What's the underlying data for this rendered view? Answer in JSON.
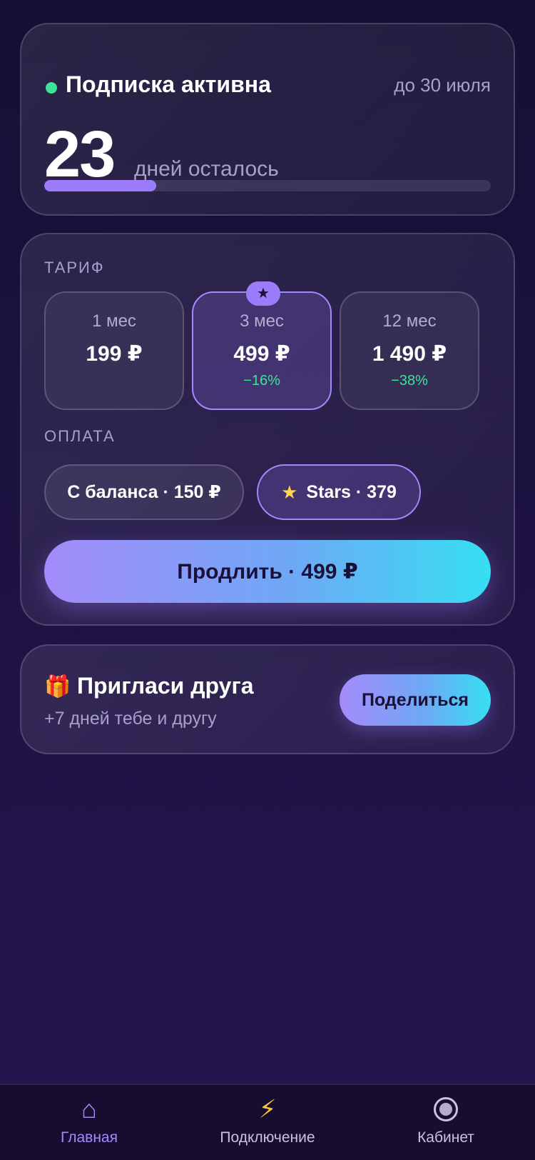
{
  "status": {
    "title": "Подписка активна",
    "until": "до 30 июля",
    "days_left": "23",
    "days_label": "дней осталось",
    "progress_fraction": 0.25,
    "dot_color": "#3ee39a"
  },
  "tariff": {
    "label": "ТАРИФ",
    "plans": [
      {
        "period": "1 мес",
        "price": "199 ₽",
        "discount": "",
        "selected": false
      },
      {
        "period": "3 мес",
        "price": "499 ₽",
        "discount": "−16%",
        "selected": true,
        "badge": "★"
      },
      {
        "period": "12 мес",
        "price": "1 490 ₽",
        "discount": "−38%",
        "selected": false
      }
    ]
  },
  "payment": {
    "label": "ОПЛАТА",
    "balance_option": "С баланса · 150 ₽",
    "stars_option": "Stars · 379",
    "stars_icon": "★",
    "selected": "stars"
  },
  "renew_button": "Продлить · 499 ₽",
  "invite": {
    "icon": "🎁",
    "title": "Пригласи друга",
    "subtitle": "+7 дней тебе и другу",
    "share_button": "Поделиться"
  },
  "nav": {
    "items": [
      {
        "label": "Главная",
        "icon": "⌂",
        "icon_name": "home-icon",
        "active": true
      },
      {
        "label": "Подключение",
        "icon": "⚡",
        "icon_name": "lightning-icon",
        "active": false
      },
      {
        "label": "Кабинет",
        "icon": "",
        "icon_name": "profile-circle-icon",
        "active": false
      }
    ]
  },
  "colors": {
    "accent": "#9b7dfb",
    "success": "#3ee39a",
    "gradient_end": "#36dff2"
  }
}
